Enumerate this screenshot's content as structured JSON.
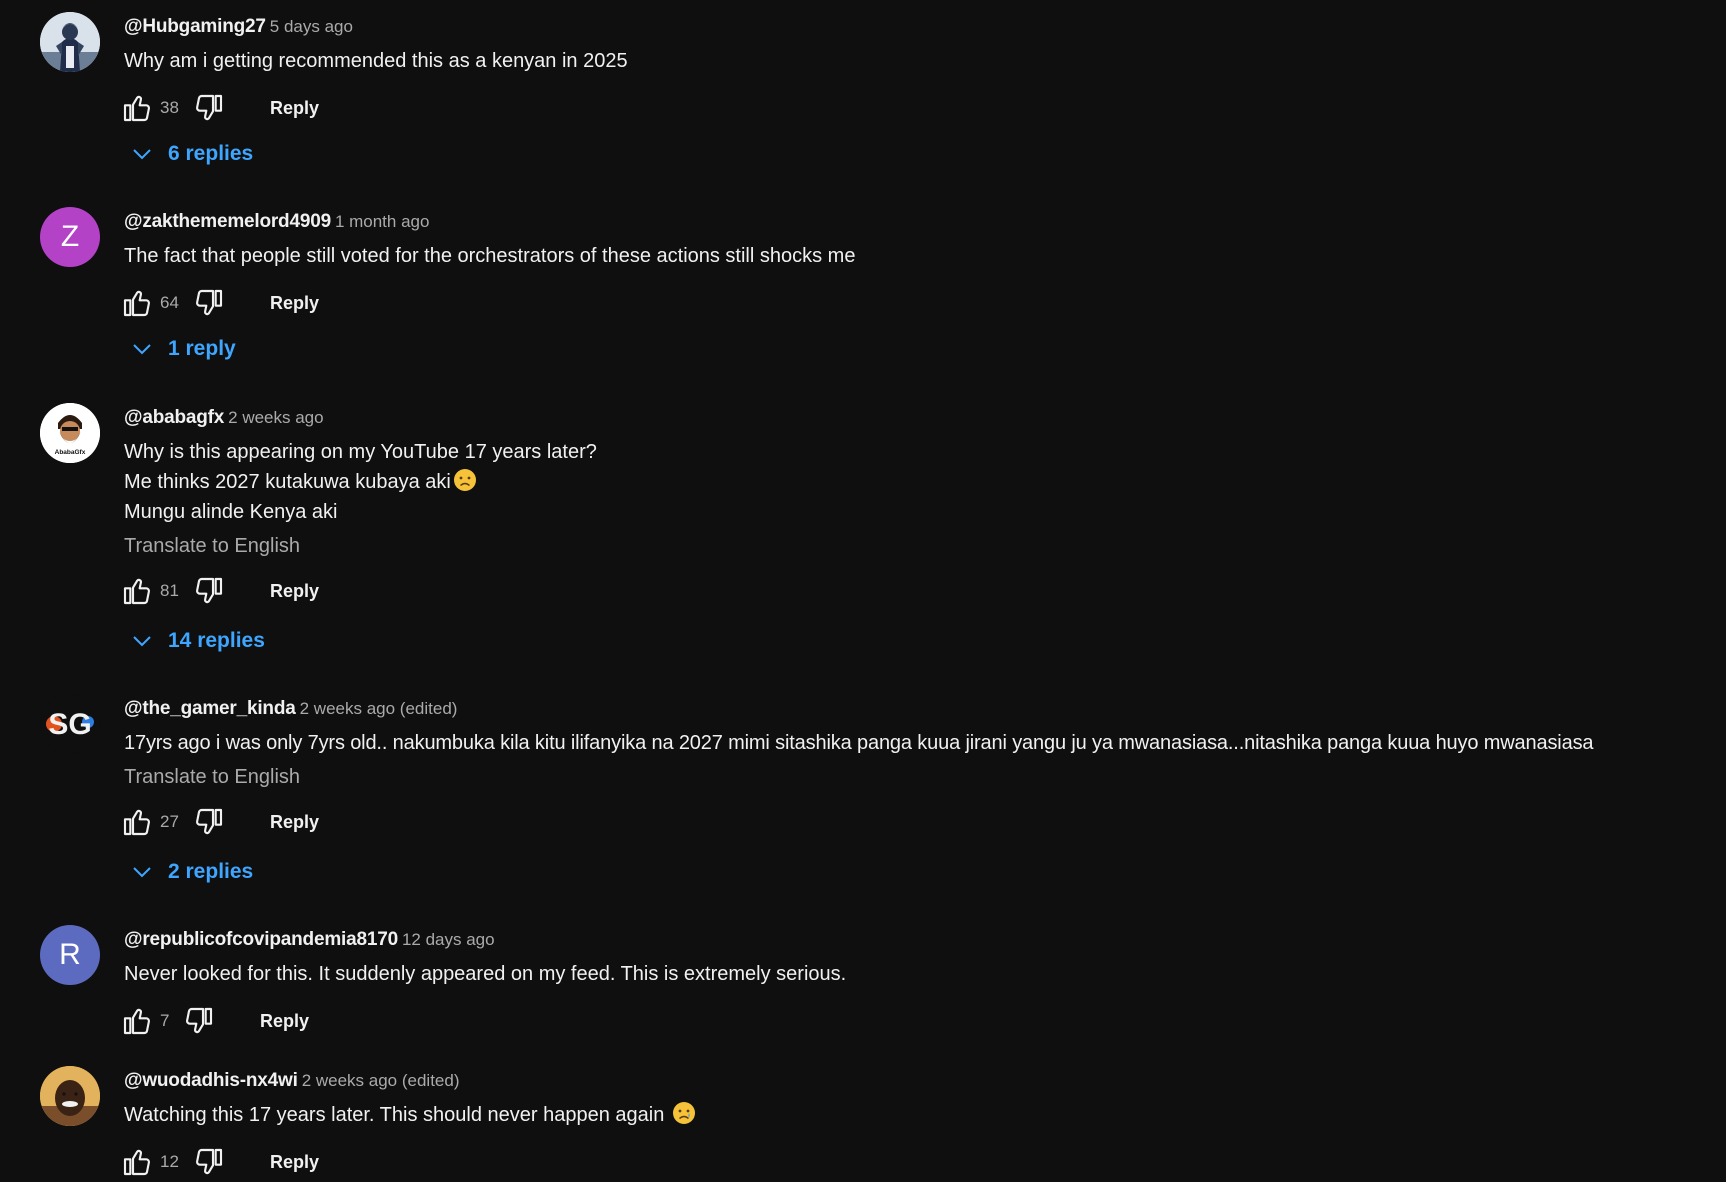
{
  "comments": [
    {
      "author": "@Hubgaming27",
      "time": "5 days ago",
      "lines": [
        "Why am i getting recommended this as a kenyan in 2025"
      ],
      "likes": "38",
      "reply_label": "Reply",
      "replies": "6 replies",
      "avatar": {
        "type": "image",
        "icon": "pubg-soldier-avatar"
      }
    },
    {
      "author": "@zakthememelord4909",
      "time": "1 month ago",
      "lines": [
        "The fact that people still voted for the orchestrators of these actions still shocks me"
      ],
      "likes": "64",
      "reply_label": "Reply",
      "replies": "1 reply",
      "avatar": {
        "type": "letter",
        "letter": "Z",
        "color": "#b342c7"
      }
    },
    {
      "author": "@ababagfx",
      "time": "2 weeks ago",
      "lines": [
        "Why is this appearing on my YouTube 17 years later?",
        "Me thinks 2027 kutakuwa kubaya aki",
        "Mungu alinde Kenya aki"
      ],
      "translate": "Translate to English",
      "likes": "81",
      "reply_label": "Reply",
      "replies": "14 replies",
      "avatar": {
        "type": "image",
        "icon": "bearded-man-logo-avatar",
        "text": "AbabaGfx"
      }
    },
    {
      "author": "@the_gamer_kinda",
      "time": "2 weeks ago (edited)",
      "lines": [
        "17yrs ago i was only 7yrs old.. nakumbuka kila kitu ilifanyika na 2027 mimi sitashika panga kuua jirani yangu ju ya mwanasiasa...nitashika panga kuua huyo mwanasiasa"
      ],
      "translate": "Translate to English",
      "likes": "27",
      "reply_label": "Reply",
      "replies": "2 replies",
      "avatar": {
        "type": "image",
        "icon": "sg-logo-avatar",
        "text": "SG"
      }
    },
    {
      "author": "@republicofcovipandemia8170",
      "time": "12 days ago",
      "lines": [
        "Never looked for this. It suddenly appeared on my feed. This is extremely serious."
      ],
      "likes": "7",
      "reply_label": "Reply",
      "avatar": {
        "type": "letter",
        "letter": "R",
        "color": "#5c6bc0"
      }
    },
    {
      "author": "@wuodadhis-nx4wi",
      "time": "2 weeks ago (edited)",
      "lines": [
        "Watching this 17 years later. This should never happen again"
      ],
      "likes": "12",
      "reply_label": "Reply",
      "avatar": {
        "type": "image",
        "icon": "smiling-man-photo-avatar"
      }
    }
  ],
  "colors": {
    "background": "#0f0f0f",
    "text": "#f1f1f1",
    "secondary": "#aaaaaa",
    "link": "#3ea6ff"
  }
}
